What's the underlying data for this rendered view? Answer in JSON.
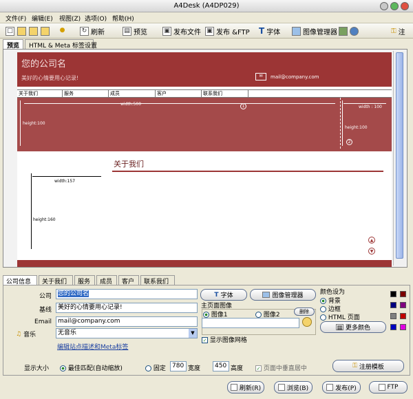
{
  "window": {
    "title": "A4Desk (A4DP029)"
  },
  "menu": [
    "文件(F)",
    "编辑(E)",
    "视图(Z)",
    "选项(O)",
    "帮助(H)"
  ],
  "toolbar": {
    "refresh": "刷新",
    "preview": "预览",
    "publish_file": "发布文件",
    "publish_ftp": "发布 &FTP",
    "font": "字体",
    "image_manager": "图像管理器",
    "register": "注"
  },
  "top_tabs": [
    "预览",
    "HTML & Meta 标签设置"
  ],
  "preview": {
    "company_name": "您的公司名",
    "slogan": "美好的心情要用心记录!",
    "email": "mail@company.com",
    "nav": [
      "关于我们",
      "服务",
      "成员",
      "客户",
      "联系我们"
    ],
    "banner_width": "width:500",
    "banner_height": "height:100",
    "side_width": "width : 100",
    "side_height": "height:100",
    "section_title": "关于我们",
    "img_width": "width:157",
    "img_height": "height:160",
    "badge1": "1",
    "badge2": "2"
  },
  "bottom_tabs": [
    "公司信息",
    "关于我们",
    "服务",
    "成员",
    "客户",
    "联系我们"
  ],
  "form": {
    "company_label": "公司",
    "company_value": "您的公司名",
    "slogan_label": "基线",
    "slogan_value": "美好的心情要用心记录!",
    "email_label": "Email",
    "email_value": "mail@company.com",
    "music_label": "音乐",
    "music_value": "无音乐",
    "meta_link": "编辑站点描述和Meta标签",
    "font_btn": "字体",
    "image_mgr_btn": "图像管理器",
    "main_image_label": "主页面图像",
    "image1": "图像1",
    "image2": "图像2",
    "delete_btn": "删除",
    "show_grid": "显示图像网格",
    "color_label": "颜色设为",
    "color_bg": "背景",
    "color_border": "边框",
    "color_html": "HTML 页面",
    "more_colors": "更多颜色",
    "display_size": "显示大小",
    "best_fit": "最佳匹配(自动缩放)",
    "fixed": "固定",
    "width_value": "780",
    "width_label": "宽度",
    "height_value": "450",
    "height_label": "高度",
    "center_vertical": "页面中垂直居中",
    "register_template": "注册模板"
  },
  "footer": {
    "refresh": "刷新(R)",
    "browse": "浏览(B)",
    "publish": "发布(P)",
    "ftp": "FTP"
  },
  "colors": {
    "header": "#9c3535",
    "banner": "#a44a4a",
    "swatches": [
      "#000000",
      "#7a0000",
      "#000080",
      "#800080",
      "#808080",
      "#c00000",
      "#0000c0",
      "#e000e0"
    ]
  }
}
